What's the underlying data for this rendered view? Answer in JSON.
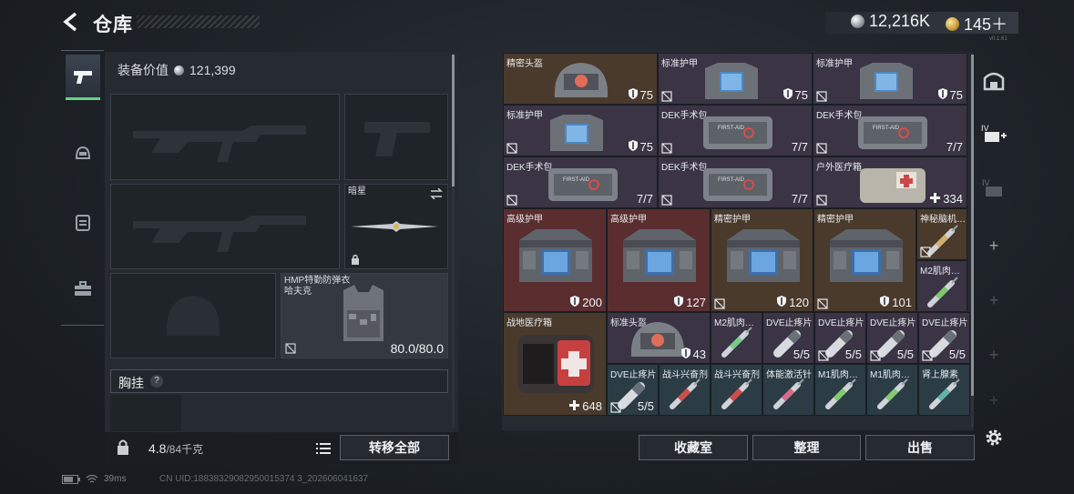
{
  "header": {
    "title": "仓库",
    "silver_amount": "12,216K",
    "gold_amount": "145＋",
    "version_text": "v0.1.61"
  },
  "left_tabs": [
    {
      "icon": "pistol-icon",
      "active": true
    },
    {
      "icon": "helmet-icon",
      "active": false
    },
    {
      "icon": "backpack-icon",
      "active": false
    },
    {
      "icon": "toolbox-icon",
      "active": false
    }
  ],
  "equipment": {
    "value_label": "装备价值",
    "value": "121,399",
    "slots": {
      "primary1": {
        "label": ""
      },
      "pistol": {
        "label": ""
      },
      "primary2": {
        "label": ""
      },
      "melee": {
        "label": "暗星"
      },
      "helmet": {
        "label": ""
      },
      "armor": {
        "label": "HMP特勤防弹衣",
        "sub": "哈夫克",
        "durability": "80.0/80.0"
      }
    },
    "chest_label": "胸挂",
    "help": "?",
    "weight": "4.8",
    "weight_max": "/84千克",
    "transfer_all": "转移全部"
  },
  "inventory": {
    "items": [
      {
        "name": "精密头盔",
        "value": "75",
        "color": "brown",
        "type": "helmet",
        "col": 0,
        "row": 0,
        "w": 1,
        "h": 1,
        "val_icon": "shield"
      },
      {
        "name": "标准护甲",
        "value": "75",
        "color": "purple",
        "type": "vest-small",
        "col": 1,
        "row": 0,
        "w": 1,
        "h": 1,
        "val_icon": "shield"
      },
      {
        "name": "标准护甲",
        "value": "75",
        "color": "purple",
        "type": "vest-small",
        "col": 2,
        "row": 0,
        "w": 1,
        "h": 1,
        "val_icon": "shield"
      },
      {
        "name": "标准护甲",
        "value": "75",
        "color": "purple",
        "type": "vest-small",
        "col": 0,
        "row": 1,
        "w": 1,
        "h": 1,
        "val_icon": "shield"
      },
      {
        "name": "DEK手术包",
        "value": "7/7",
        "color": "purple",
        "type": "surgkit",
        "col": 1,
        "row": 1,
        "w": 1,
        "h": 1,
        "val_icon": ""
      },
      {
        "name": "DEK手术包",
        "value": "7/7",
        "color": "purple",
        "type": "surgkit",
        "col": 2,
        "row": 1,
        "w": 1,
        "h": 1,
        "val_icon": ""
      },
      {
        "name": "DEK手术包",
        "value": "7/7",
        "color": "purple",
        "type": "surgkit",
        "col": 0,
        "row": 2,
        "w": 1,
        "h": 1,
        "val_icon": ""
      },
      {
        "name": "DEK手术包",
        "value": "7/7",
        "color": "purple",
        "type": "surgkit",
        "col": 1,
        "row": 2,
        "w": 1,
        "h": 1,
        "val_icon": ""
      },
      {
        "name": "户外医疗箱",
        "value": "334",
        "color": "purple",
        "type": "medbox",
        "col": 2,
        "row": 2,
        "w": 1,
        "h": 1,
        "val_icon": "plus"
      }
    ],
    "big_items": [
      {
        "name": "高级护甲",
        "value": "200",
        "color": "red"
      },
      {
        "name": "高级护甲",
        "value": "127",
        "color": "red"
      },
      {
        "name": "精密护甲",
        "value": "120",
        "color": "brown"
      },
      {
        "name": "精密护甲",
        "value": "101",
        "color": "brown"
      }
    ],
    "small_right": [
      {
        "name": "神秘脑机…",
        "color": "brown"
      },
      {
        "name": "M2肌肉…",
        "color": "purple"
      }
    ],
    "field_kit": {
      "name": "战地医疗箱",
      "value": "648",
      "color": "brown"
    },
    "helmet2": {
      "name": "标准头盔",
      "value": "43",
      "color": "purple"
    },
    "row4": [
      {
        "name": "M2肌肉…",
        "value": "",
        "color": "purple"
      },
      {
        "name": "DVE止疼片",
        "value": "5/5",
        "color": "purple"
      },
      {
        "name": "DVE止疼片",
        "value": "5/5",
        "color": "purple"
      },
      {
        "name": "DVE止疼片",
        "value": "5/5",
        "color": "purple"
      },
      {
        "name": "DVE止疼片",
        "value": "5/5",
        "color": "purple"
      }
    ],
    "row5": [
      {
        "name": "DVE止疼片",
        "value": "5/5",
        "color": "blue"
      },
      {
        "name": "战斗兴奋剂",
        "value": "",
        "color": "blue"
      },
      {
        "name": "战斗兴奋剂",
        "value": "",
        "color": "blue"
      },
      {
        "name": "体能激活针",
        "value": "",
        "color": "blue"
      },
      {
        "name": "M1肌肉…",
        "value": "",
        "color": "blue"
      },
      {
        "name": "M1肌肉…",
        "value": "",
        "color": "blue"
      },
      {
        "name": "肾上腺素",
        "value": "",
        "color": "blue"
      }
    ]
  },
  "footer": {
    "vault": "收藏室",
    "organize": "整理",
    "sell": "出售",
    "ping": "39ms",
    "uid": "CN UID:18838329082950015374 3_202606041637"
  }
}
